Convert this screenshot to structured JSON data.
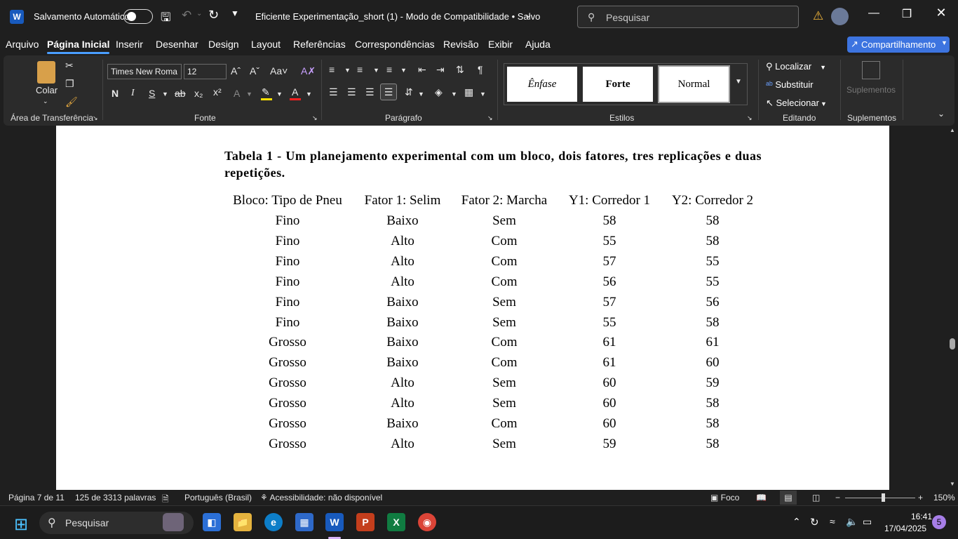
{
  "titlebar": {
    "autosave_label": "Salvamento Automático",
    "doc_title": "Eficiente Experimentação_short (1)  -  Modo de Compatibilidade  •  Salvo",
    "search_placeholder": "Pesquisar"
  },
  "menu": {
    "tabs": [
      "Arquivo",
      "Página Inicial",
      "Inserir",
      "Desenhar",
      "Design",
      "Layout",
      "Referências",
      "Correspondências",
      "Revisão",
      "Exibir",
      "Ajuda"
    ],
    "share_label": "Compartilhamento"
  },
  "ribbon": {
    "clipboard": {
      "paste_label": "Colar",
      "group_label": "Área de Transferência"
    },
    "font": {
      "family": "Times New Roma",
      "size": "12",
      "group_label": "Fonte",
      "bold": "N",
      "italic": "I",
      "underline": "S",
      "strike": "ab",
      "sub": "x₂",
      "sup": "x²"
    },
    "paragraph": {
      "group_label": "Parágrafo"
    },
    "styles": {
      "items": [
        "Ênfase",
        "Forte",
        "Normal"
      ],
      "group_label": "Estilos"
    },
    "editing": {
      "find": "Localizar",
      "replace": "Substituir",
      "select": "Selecionar",
      "group_label": "Editando"
    },
    "addins": {
      "label": "Suplementos",
      "group_label": "Suplementos"
    }
  },
  "document": {
    "caption": "Tabela 1 - Um planejamento experimental com um bloco, dois fatores, tres replicações e duas repetições.",
    "headers": [
      "Bloco: Tipo de Pneu",
      "Fator 1: Selim",
      "Fator 2: Marcha",
      "Y1: Corredor 1",
      "Y2: Corredor 2"
    ],
    "rows": [
      [
        "Fino",
        "Baixo",
        "Sem",
        "58",
        "58"
      ],
      [
        "Fino",
        "Alto",
        "Com",
        "55",
        "58"
      ],
      [
        "Fino",
        "Alto",
        "Com",
        "57",
        "55"
      ],
      [
        "Fino",
        "Alto",
        "Com",
        "56",
        "55"
      ],
      [
        "Fino",
        "Baixo",
        "Sem",
        "57",
        "56"
      ],
      [
        "Fino",
        "Baixo",
        "Sem",
        "55",
        "58"
      ],
      [
        "Grosso",
        "Baixo",
        "Com",
        "61",
        "61"
      ],
      [
        "Grosso",
        "Baixo",
        "Com",
        "61",
        "60"
      ],
      [
        "Grosso",
        "Alto",
        "Sem",
        "60",
        "59"
      ],
      [
        "Grosso",
        "Alto",
        "Sem",
        "60",
        "58"
      ],
      [
        "Grosso",
        "Baixo",
        "Com",
        "60",
        "58"
      ],
      [
        "Grosso",
        "Alto",
        "Sem",
        "59",
        "58"
      ]
    ]
  },
  "status": {
    "page": "Página 7 de 11",
    "words": "125 de 3313 palavras",
    "language": "Português (Brasil)",
    "accessibility": "Acessibilidade: não disponível",
    "focus": "Foco",
    "zoom": "150%"
  },
  "taskbar": {
    "search_label": "Pesquisar",
    "time": "16:41",
    "date": "17/04/2025",
    "notification_count": "5"
  }
}
